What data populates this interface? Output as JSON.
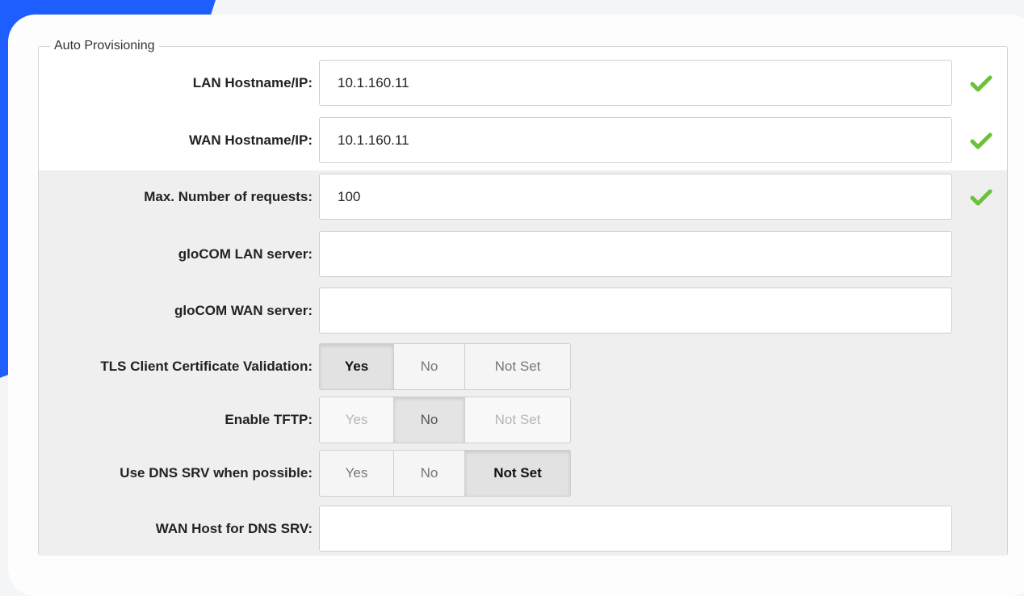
{
  "section": {
    "title": "Auto Provisioning"
  },
  "fields": {
    "lan_host": {
      "label": "LAN Hostname/IP:",
      "value": "10.1.160.11",
      "valid": true
    },
    "wan_host": {
      "label": "WAN Hostname/IP:",
      "value": "10.1.160.11",
      "valid": true
    },
    "max_requests": {
      "label": "Max. Number of requests:",
      "value": "100",
      "valid": true
    },
    "glocom_lan": {
      "label": "gloCOM LAN server:",
      "value": ""
    },
    "glocom_wan": {
      "label": "gloCOM WAN server:",
      "value": ""
    },
    "tls_validation": {
      "label": "TLS Client Certificate Validation:",
      "options": [
        "Yes",
        "No",
        "Not Set"
      ],
      "selected": "Yes"
    },
    "enable_tftp": {
      "label": "Enable TFTP:",
      "options": [
        "Yes",
        "No",
        "Not Set"
      ],
      "selected": "No",
      "disabled": true
    },
    "dns_srv": {
      "label": "Use DNS SRV when possible:",
      "options": [
        "Yes",
        "No",
        "Not Set"
      ],
      "selected": "Not Set"
    },
    "wan_host_dns_srv": {
      "label": "WAN Host for DNS SRV:",
      "value": ""
    }
  },
  "colors": {
    "accent": "#1e5eff",
    "valid_check": "#6cc13a"
  },
  "icons": {
    "valid": "checkmark-icon"
  }
}
